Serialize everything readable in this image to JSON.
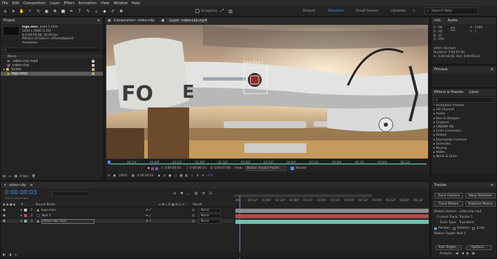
{
  "menu": [
    "File",
    "Edit",
    "Composition",
    "Layer",
    "Effect",
    "Animation",
    "View",
    "Window",
    "Help"
  ],
  "toolbar": {
    "snapping": "Snapping",
    "workspaces": [
      "Default",
      "Standard",
      "Small Screen",
      "Libraries"
    ],
    "search": "Search Help"
  },
  "project": {
    "tab": "Project",
    "asset_name": "logo.mov",
    "asset_used": ", used 1 time",
    "asset_info": [
      "1920 x 1080 (1.00)",
      "Δ 0:00:05:00, 30.00 fps",
      "Millions of Colors+ (Premultiplied)",
      "Animation"
    ],
    "column_name": "Name",
    "items": [
      {
        "name": "video-clip.mp4",
        "icon": "footage",
        "color": "#c9c9c9"
      },
      {
        "name": "video-clip",
        "icon": "comp",
        "color": "#c9c9c9"
      },
      {
        "name": "Solids",
        "icon": "folder",
        "color": "#e0b64d"
      },
      {
        "name": "logo.mov",
        "icon": "footage",
        "color": "#a0a0a0"
      }
    ],
    "footer": "8 bpc"
  },
  "composition": {
    "tab": "Composition: video-clip",
    "layer_tab": "Layer: video-clip.mp4",
    "track_point_label": "Track Point 1",
    "ruler": [
      "00:12f",
      "01:00f",
      "01:12f",
      "02:00f",
      "02:12f",
      "03:00f",
      "03:12f",
      "04:00f",
      "04:12f",
      "05:00f",
      "05:12f",
      "06:00f",
      "06:12f"
    ],
    "timecode_a": "0:00:00:03",
    "timecode_b": "0:00:06:23",
    "timecode_c": "0:00:07:00",
    "view_label": "View:",
    "view_value": "Motion Tracker Points",
    "render_label": "Render",
    "zoom": "200%",
    "time_display": "0:00:00:03",
    "plus": "+0.0"
  },
  "info": {
    "tabs": [
      "Info",
      "Audio"
    ],
    "rgb": [
      "R : 66",
      "G : 44",
      "B : 37",
      "A : 255"
    ],
    "xy": [
      "X : 1260",
      "Y : 1"
    ],
    "lines": [
      "video-clip.mp4",
      "Duration: 0:00:07:00",
      "In: 0:00:00:00, Out: 0:00:06:23"
    ]
  },
  "preview": {
    "tab": "Preview"
  },
  "effects": {
    "tabs": [
      "Effects & Presets",
      "Librar"
    ],
    "items": [
      "* Animation Presets",
      "3D Channel",
      "Audio",
      "Blur & Sharpen",
      "Channel",
      "CINEMA 4D",
      "Color Correction",
      "Distort",
      "Expression Controls",
      "Generate",
      "Keying",
      "Matte",
      "Noise & Grain"
    ]
  },
  "timeline": {
    "tab": "video-clip",
    "timecode": "0:00:00:03",
    "frame_info": "00003 (30.00 fps)",
    "columns": {
      "source": "Source Name",
      "parent": "Parent"
    },
    "layers": [
      {
        "num": "1",
        "name": "logo.mov",
        "parent": "None",
        "color": "#c9c9c9"
      },
      {
        "num": "2",
        "name": "Null 1",
        "parent": "None",
        "color": "#d24b4b"
      },
      {
        "num": "3",
        "name": "video-clip.mp4",
        "parent": "None",
        "color": "#6fbfae"
      }
    ],
    "ruler": [
      "00s",
      "00:12f",
      "01:00f",
      "01:12f",
      "02:00f",
      "02:12f",
      "03:00f",
      "03:12f",
      "04:00f",
      "04:12f",
      "05:00f",
      "05:12f",
      "06:00f",
      "06:12f"
    ]
  },
  "tracker": {
    "tab": "Tracker",
    "buttons": [
      "Track Camera",
      "Warp Stabilizer",
      "Track Motion",
      "Stabilize Motion"
    ],
    "motion_source_label": "Motion Source:",
    "motion_source": "video-clip.mp4",
    "current_track_label": "Current Track:",
    "current_track": "Tracker 1",
    "track_type_label": "Track Type:",
    "track_type": "Transform",
    "position": "Position",
    "rotation": "Rotation",
    "scale": "Scale",
    "motion_target": "Motion Target: Null 1",
    "edit_target": "Edit Target...",
    "options": "Options...",
    "analyze": "Analyze:"
  },
  "colors": {
    "accent": "#4e8fe6",
    "track_green": "#6fbfae",
    "track_red": "#b04a4a",
    "track_gray": "#8a8a8a"
  }
}
